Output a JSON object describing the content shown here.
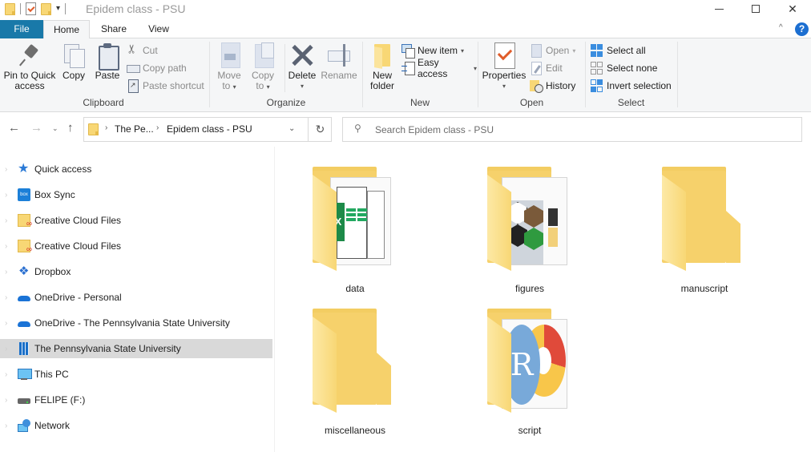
{
  "window": {
    "title": "Epidem class - PSU",
    "controls": {
      "minimize": "minimize",
      "maximize": "maximize",
      "close": "close"
    }
  },
  "quick_access_toolbar": {
    "items": [
      "folder-icon",
      "properties-icon",
      "new-folder-icon"
    ],
    "customize_glyph": "▾"
  },
  "tabs": [
    {
      "label": "File",
      "active": false
    },
    {
      "label": "Home",
      "active": true
    },
    {
      "label": "Share",
      "active": false
    },
    {
      "label": "View",
      "active": false
    }
  ],
  "ribbon": {
    "collapse_glyph": "^",
    "help_glyph": "?",
    "groups": {
      "clipboard": {
        "label": "Clipboard",
        "pin": "Pin to Quick access",
        "pin_line1": "Pin to Quick",
        "pin_line2": "access",
        "copy": "Copy",
        "paste": "Paste",
        "cut": "Cut",
        "copy_path": "Copy path",
        "paste_shortcut": "Paste shortcut"
      },
      "organize": {
        "label": "Organize",
        "move_to_line1": "Move",
        "move_to_line2": "to",
        "copy_to_line1": "Copy",
        "copy_to_line2": "to",
        "delete": "Delete",
        "rename": "Rename"
      },
      "new": {
        "label": "New",
        "new_folder_line1": "New",
        "new_folder_line2": "folder",
        "new_item": "New item",
        "easy_access": "Easy access"
      },
      "open": {
        "label": "Open",
        "properties": "Properties",
        "open": "Open",
        "edit": "Edit",
        "history": "History"
      },
      "select": {
        "label": "Select",
        "select_all": "Select all",
        "select_none": "Select none",
        "invert_selection": "Invert selection"
      }
    }
  },
  "address_bar": {
    "back": "←",
    "forward": "→",
    "recent": "⌄",
    "up": "↑",
    "breadcrumbs": [
      "The Pe...",
      "Epidem class - PSU"
    ],
    "separator": "›",
    "dropdown": "⌄",
    "refresh": "↻"
  },
  "search": {
    "placeholder": "Search Epidem class - PSU",
    "value": ""
  },
  "nav_pane": {
    "items": [
      {
        "label": "Quick access",
        "icon": "quick-access-icon",
        "selected": false
      },
      {
        "label": "Box Sync",
        "icon": "box-icon",
        "selected": false
      },
      {
        "label": "Creative Cloud Files",
        "icon": "creative-cloud-icon",
        "selected": false
      },
      {
        "label": "Creative Cloud Files",
        "icon": "creative-cloud-icon",
        "selected": false
      },
      {
        "label": "Dropbox",
        "icon": "dropbox-icon",
        "selected": false
      },
      {
        "label": "OneDrive - Personal",
        "icon": "onedrive-icon",
        "selected": false
      },
      {
        "label": "OneDrive - The Pennsylvania State University",
        "icon": "onedrive-icon",
        "selected": false
      },
      {
        "label": "The Pennsylvania State University",
        "icon": "organization-icon",
        "selected": true
      },
      {
        "label": "This PC",
        "icon": "this-pc-icon",
        "selected": false
      },
      {
        "label": "FELIPE (F:)",
        "icon": "drive-icon",
        "selected": false
      },
      {
        "label": "Network",
        "icon": "network-icon",
        "selected": false
      }
    ]
  },
  "content": {
    "folders": [
      {
        "name": "data",
        "preview": "spreadsheets"
      },
      {
        "name": "figures",
        "preview": "images"
      },
      {
        "name": "manuscript",
        "preview": "empty"
      },
      {
        "name": "miscellaneous",
        "preview": "empty"
      },
      {
        "name": "script",
        "preview": "r-scripts"
      }
    ],
    "r_logo_letter": "R",
    "xls_letter": "X"
  },
  "colors": {
    "file_tab": "#1979a9",
    "ribbon_bg": "#f5f6f7",
    "selected_nav": "#d9d9d9",
    "folder_yellow": "#f8d775",
    "accent_blue": "#1c6fd1"
  }
}
